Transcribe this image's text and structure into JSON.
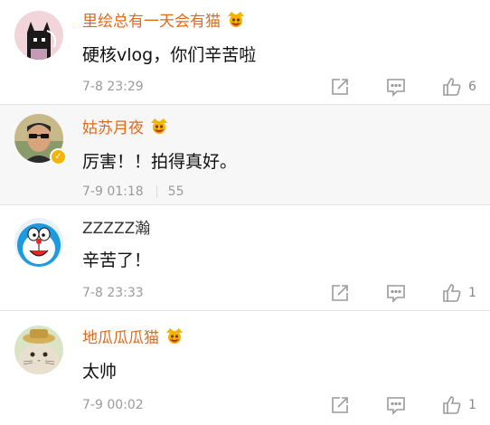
{
  "comments": [
    {
      "username": "里绘总有一天会有猫",
      "text": "硬核vlog，你们辛苦啦",
      "date": "7-8 23:29",
      "likes": "6",
      "avatar_icon": "cat-girl-avatar",
      "has_crown_badge": true
    },
    {
      "username": "姑苏月夜",
      "text": "厉害！！拍得真好。",
      "date": "7-9 01:18",
      "likes": "55",
      "avatar_icon": "sunglasses-man-avatar",
      "has_crown_badge": true,
      "verified": true
    },
    {
      "username": "ZZZZZ瀚",
      "text": "辛苦了！",
      "date": "7-8 23:33",
      "likes": "1",
      "avatar_icon": "doraemon-avatar",
      "has_crown_badge": false
    },
    {
      "username": "地瓜瓜瓜猫",
      "text": "太帅",
      "date": "7-9 00:02",
      "likes": "1",
      "avatar_icon": "cat-with-hat-avatar",
      "has_crown_badge": true
    }
  ],
  "colors": {
    "username": "#e06a1c",
    "badge": "#f5b400",
    "meta": "#9a9a9a",
    "icon": "#9a9a9a"
  },
  "icons": {
    "share": "share-icon",
    "comment": "comment-icon",
    "like": "thumbs-up-icon"
  }
}
